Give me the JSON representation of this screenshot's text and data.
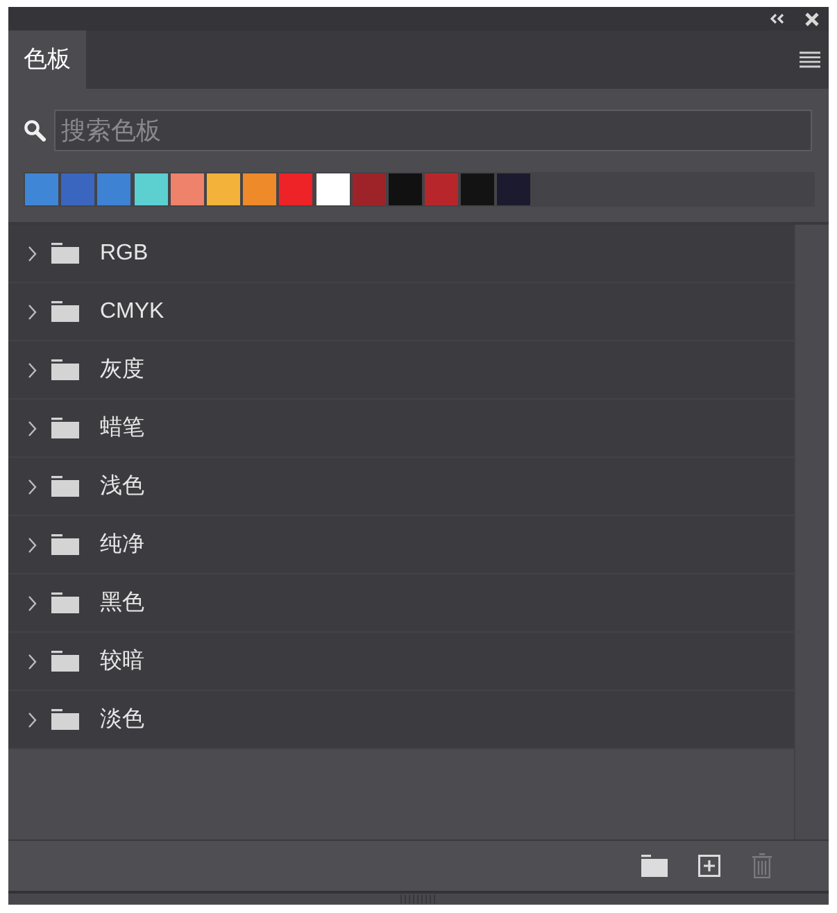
{
  "tabs": [
    {
      "label": "色板",
      "selected": true
    }
  ],
  "search": {
    "placeholder": "搜索色板"
  },
  "swatches": [
    {
      "color": "#3f86d6"
    },
    {
      "color": "#3a66bf"
    },
    {
      "color": "#3d82d3"
    },
    {
      "color": "#5ccfd0"
    },
    {
      "color": "#ee826a"
    },
    {
      "color": "#f3b23a"
    },
    {
      "color": "#ee8a2a"
    },
    {
      "color": "#ed2328"
    },
    {
      "color": "#ffffff"
    },
    {
      "color": "#9e2329"
    },
    {
      "color": "#111111"
    },
    {
      "color": "#b7262b"
    },
    {
      "color": "#131313"
    },
    {
      "color": "#1b1a2e"
    }
  ],
  "groups": [
    {
      "label": "RGB",
      "expanded": false
    },
    {
      "label": "CMYK",
      "expanded": false
    },
    {
      "label": "灰度",
      "expanded": false
    },
    {
      "label": "蜡笔",
      "expanded": false
    },
    {
      "label": "浅色",
      "expanded": false
    },
    {
      "label": "纯净",
      "expanded": false
    },
    {
      "label": "黑色",
      "expanded": false
    },
    {
      "label": "较暗",
      "expanded": false
    },
    {
      "label": "淡色",
      "expanded": false
    }
  ],
  "footer_buttons": [
    {
      "kind": "new-group",
      "disabled": false
    },
    {
      "kind": "new-swatch",
      "disabled": false
    },
    {
      "kind": "delete",
      "disabled": true
    }
  ]
}
